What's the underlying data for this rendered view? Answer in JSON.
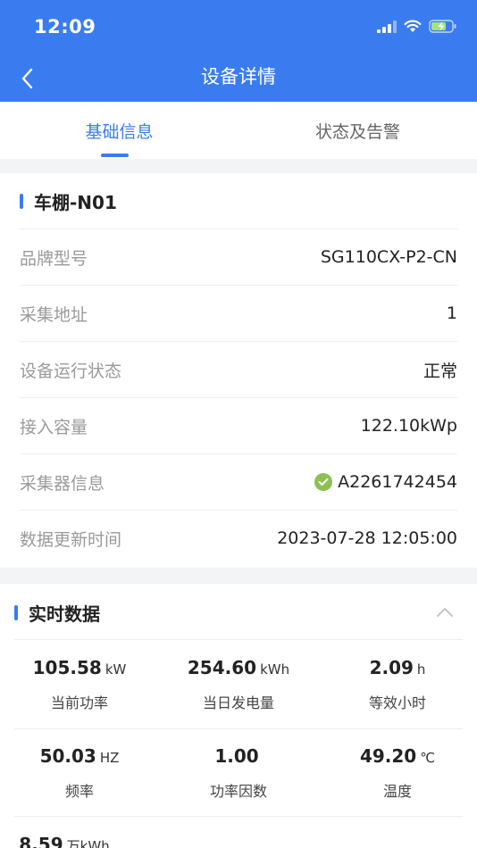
{
  "status_bar": {
    "time": "12:09"
  },
  "nav": {
    "title": "设备详情"
  },
  "tabs": [
    {
      "label": "基础信息",
      "active": true
    },
    {
      "label": "状态及告警",
      "active": false
    }
  ],
  "device": {
    "name": "车棚-N01",
    "fields": [
      {
        "label": "品牌型号",
        "value": "SG110CX-P2-CN"
      },
      {
        "label": "采集地址",
        "value": "1"
      },
      {
        "label": "设备运行状态",
        "value": "正常"
      },
      {
        "label": "接入容量",
        "value": "122.10kWp"
      },
      {
        "label": "采集器信息",
        "value": "A2261742454",
        "status_icon": "check-circle-icon"
      },
      {
        "label": "数据更新时间",
        "value": "2023-07-28 12:05:00"
      }
    ]
  },
  "realtime": {
    "title": "实时数据",
    "metrics": [
      {
        "value": "105.58",
        "unit": "kW",
        "label": "当前功率"
      },
      {
        "value": "254.60",
        "unit": "kWh",
        "label": "当日发电量"
      },
      {
        "value": "2.09",
        "unit": "h",
        "label": "等效小时"
      },
      {
        "value": "50.03",
        "unit": "HZ",
        "label": "频率"
      },
      {
        "value": "1.00",
        "unit": "",
        "label": "功率因数"
      },
      {
        "value": "49.20",
        "unit": "℃",
        "label": "温度"
      },
      {
        "value": "8.59",
        "unit": "万kWh",
        "label": ""
      }
    ]
  },
  "colors": {
    "primary": "#3a7cf0",
    "success": "#8cc152"
  }
}
